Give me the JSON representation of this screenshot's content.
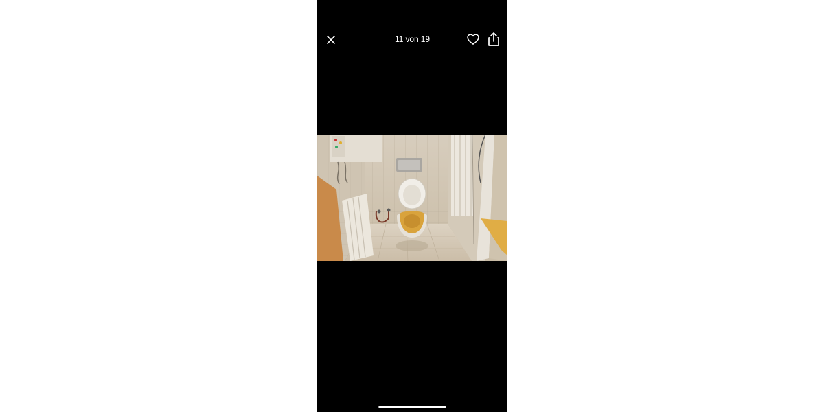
{
  "viewer": {
    "counter_text": "11 von 19",
    "close_icon": "close-icon",
    "like_icon": "heart-outline-icon",
    "share_icon": "share-icon"
  },
  "photo": {
    "subject": "bathroom",
    "colors": {
      "wall_tile": "#d9d0c0",
      "floor_tile": "#d6cab8",
      "toilet_seat": "#d9a33c",
      "door": "#c98a4a"
    }
  },
  "colors": {
    "background": "#000000",
    "page": "#ffffff",
    "foreground": "#ffffff"
  }
}
